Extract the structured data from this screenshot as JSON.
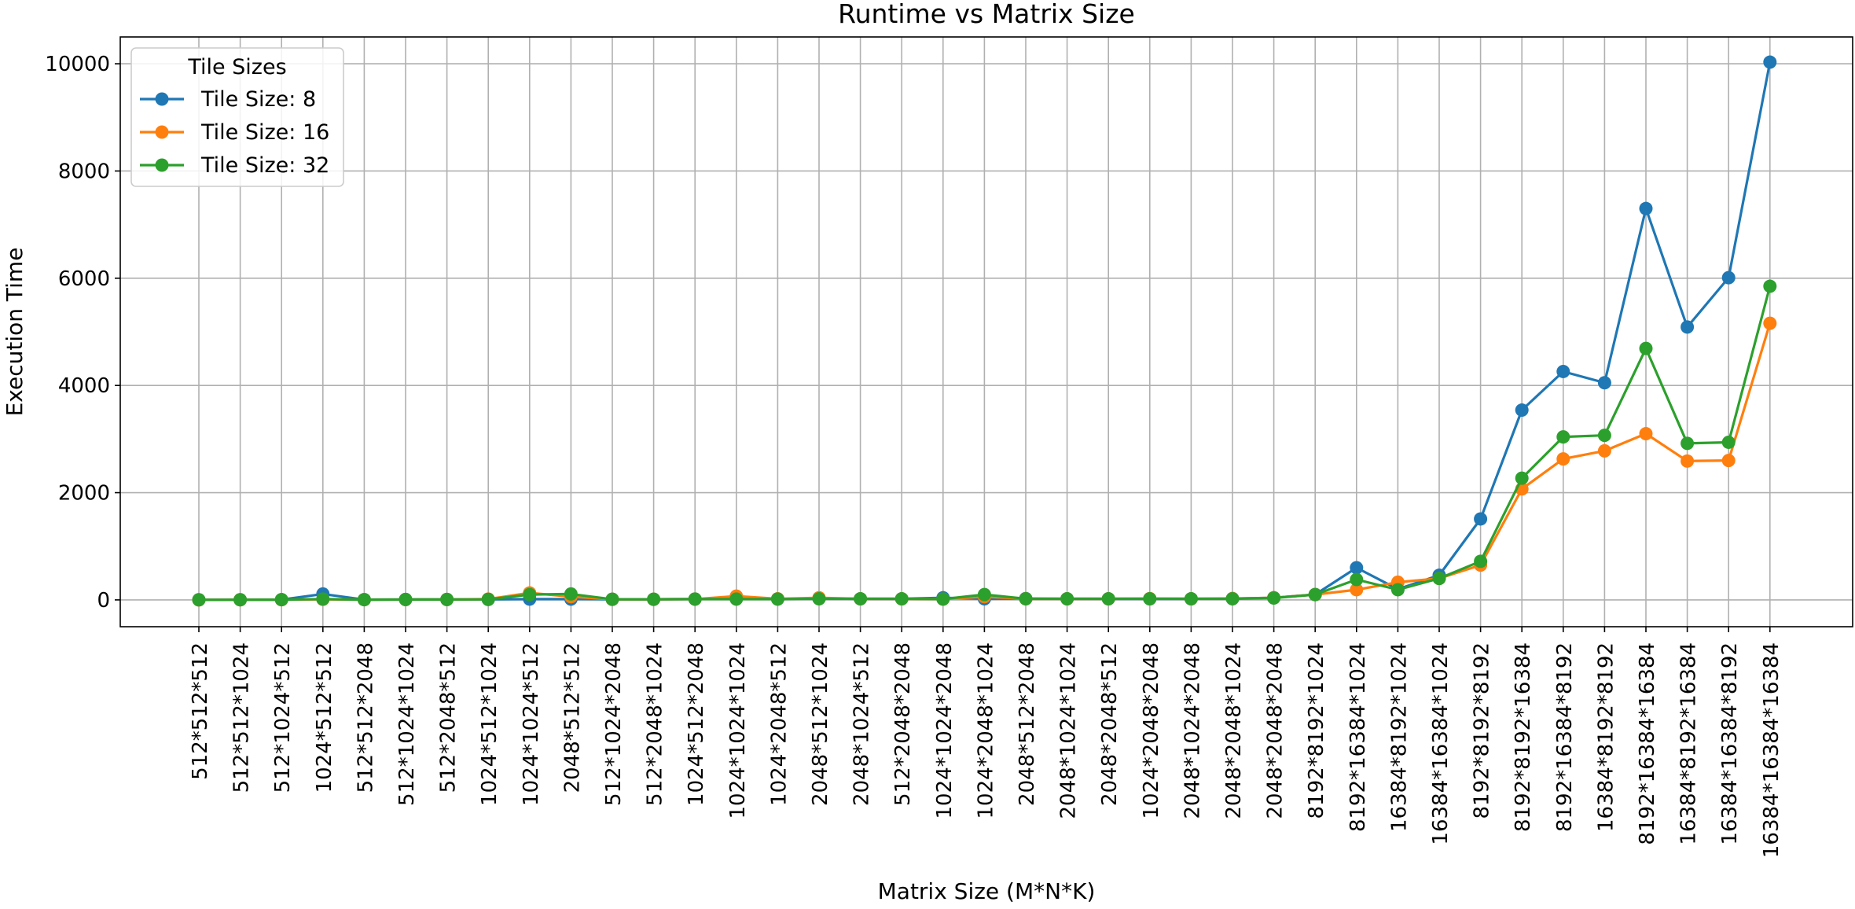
{
  "chart_data": {
    "type": "line",
    "title": "Runtime vs Matrix Size",
    "xlabel": "Matrix Size (M*N*K)",
    "ylabel": "Execution Time",
    "ylim": [
      -500,
      10500
    ],
    "yticks": [
      0,
      2000,
      4000,
      6000,
      8000,
      10000
    ],
    "grid": true,
    "legend": {
      "title": "Tile Sizes",
      "placement": "top-left"
    },
    "categories": [
      "512*512*512",
      "512*512*1024",
      "512*1024*512",
      "1024*512*512",
      "512*512*2048",
      "512*1024*1024",
      "512*2048*512",
      "1024*512*1024",
      "1024*1024*512",
      "2048*512*512",
      "512*1024*2048",
      "512*2048*1024",
      "1024*512*2048",
      "1024*1024*1024",
      "1024*2048*512",
      "2048*512*1024",
      "2048*1024*512",
      "512*2048*2048",
      "1024*1024*2048",
      "1024*2048*1024",
      "2048*512*2048",
      "2048*1024*1024",
      "2048*2048*512",
      "1024*2048*2048",
      "2048*1024*2048",
      "2048*2048*1024",
      "2048*2048*2048",
      "8192*8192*1024",
      "8192*16384*1024",
      "16384*8192*1024",
      "16384*16384*1024",
      "8192*8192*8192",
      "8192*8192*16384",
      "8192*16384*8192",
      "16384*8192*8192",
      "8192*16384*16384",
      "16384*8192*16384",
      "16384*16384*8192",
      "16384*16384*16384"
    ],
    "series": [
      {
        "name": "Tile Size: 8",
        "color": "#1f77b4",
        "values": [
          2,
          3,
          5,
          110,
          5,
          8,
          8,
          10,
          15,
          15,
          12,
          12,
          15,
          30,
          18,
          25,
          20,
          20,
          40,
          20,
          25,
          20,
          20,
          20,
          20,
          25,
          40,
          100,
          600,
          200,
          460,
          1510,
          3540,
          4260,
          4050,
          7300,
          5090,
          6010,
          10030
        ]
      },
      {
        "name": "Tile Size: 16",
        "color": "#ff7f0e",
        "values": [
          1,
          2,
          3,
          12,
          5,
          6,
          8,
          15,
          130,
          60,
          12,
          12,
          15,
          70,
          20,
          40,
          20,
          20,
          15,
          60,
          20,
          20,
          20,
          25,
          20,
          25,
          40,
          100,
          190,
          330,
          400,
          650,
          2070,
          2630,
          2780,
          3100,
          2590,
          2600,
          5160
        ]
      },
      {
        "name": "Tile Size: 32",
        "color": "#2ca02c",
        "values": [
          2,
          3,
          5,
          15,
          5,
          8,
          8,
          10,
          100,
          110,
          12,
          12,
          15,
          15,
          15,
          20,
          20,
          20,
          15,
          100,
          20,
          20,
          20,
          20,
          20,
          20,
          35,
          100,
          380,
          190,
          400,
          720,
          2270,
          3040,
          3070,
          4690,
          2920,
          2940,
          5850
        ]
      }
    ]
  }
}
